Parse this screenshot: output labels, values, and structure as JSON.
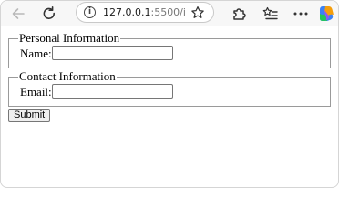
{
  "browser": {
    "url_host": "127.0.0.1",
    "url_path": ":5500/in..."
  },
  "form": {
    "personal": {
      "legend": "Personal Information",
      "name_label": "Name:",
      "name_value": ""
    },
    "contact": {
      "legend": "Contact Information",
      "email_label": "Email:",
      "email_value": ""
    },
    "submit_label": "Submit"
  }
}
